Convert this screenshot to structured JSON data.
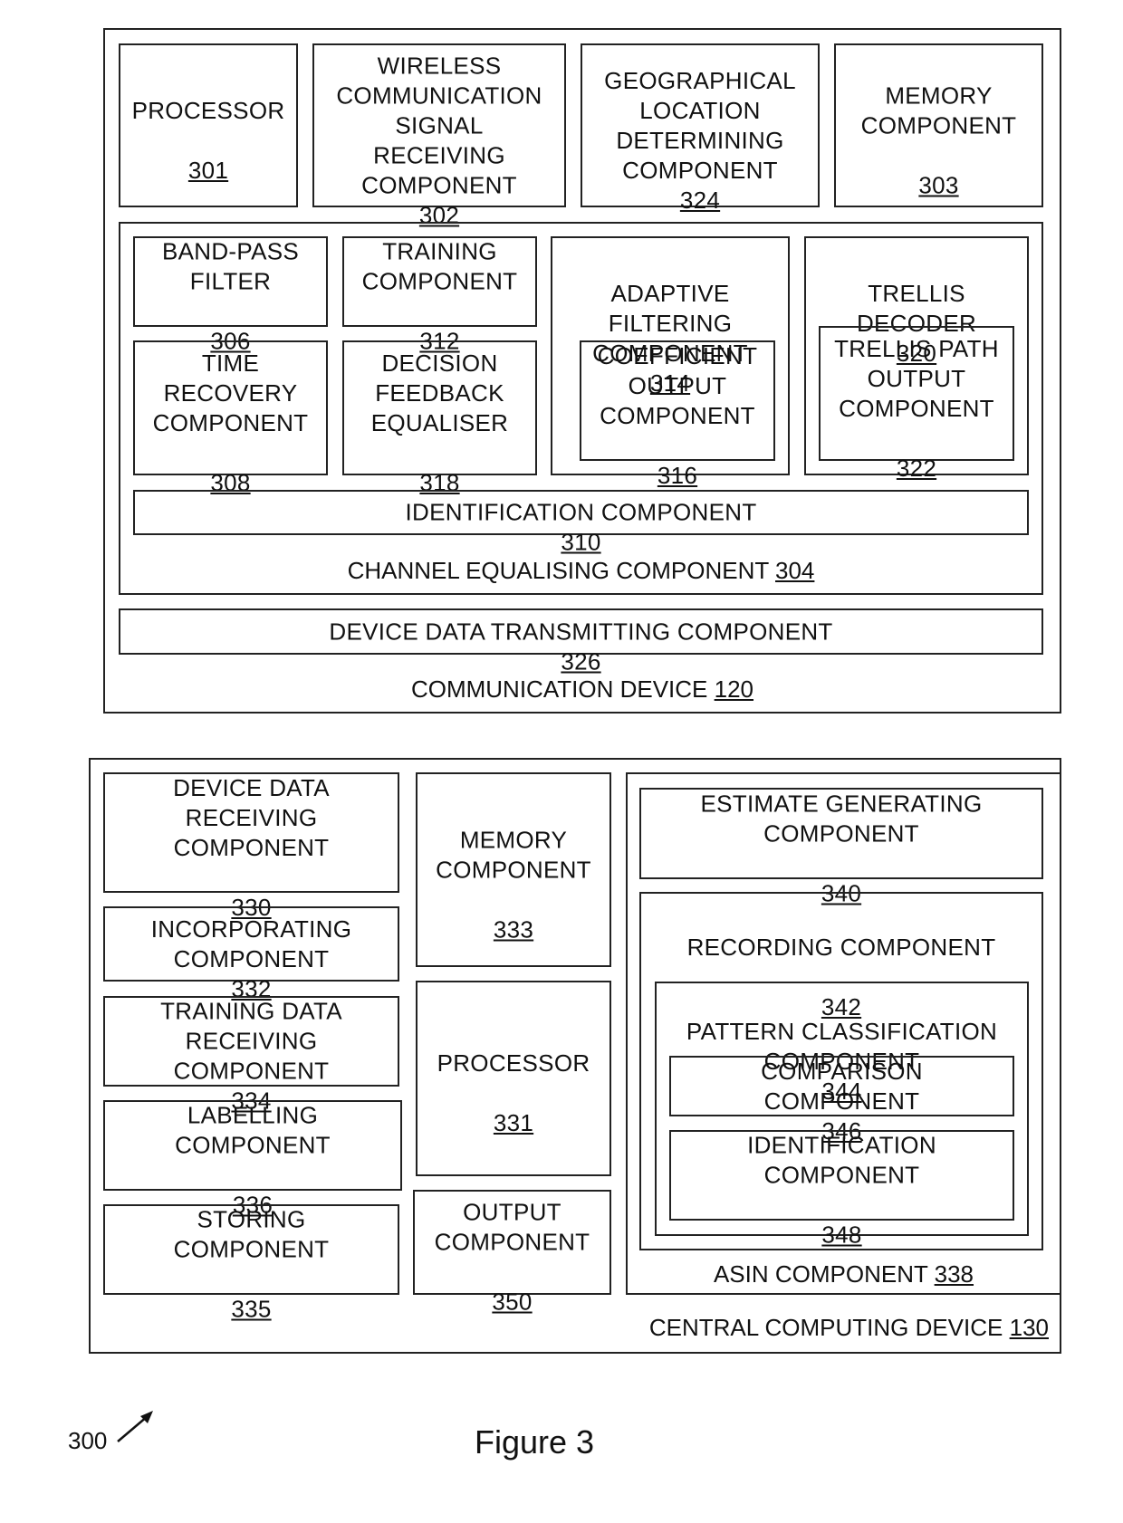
{
  "figure": {
    "caption": "Figure 3",
    "reference": "300"
  },
  "communication_device": {
    "label": "COMMUNICATION DEVICE",
    "num": "120",
    "processor": {
      "label": "PROCESSOR",
      "num": "301"
    },
    "wireless": {
      "label": "WIRELESS\nCOMMUNICATION\nSIGNAL\nRECEIVING\nCOMPONENT",
      "num": "302"
    },
    "geo": {
      "label": "GEOGRAPHICAL\nLOCATION\nDETERMINING\nCOMPONENT",
      "num": "324"
    },
    "memory": {
      "label": "MEMORY\nCOMPONENT",
      "num": "303"
    },
    "channel_equalising": {
      "label": "CHANNEL EQUALISING COMPONENT",
      "num": "304",
      "band_pass": {
        "label": "BAND-PASS\nFILTER",
        "num": "306"
      },
      "training": {
        "label": "TRAINING\nCOMPONENT",
        "num": "312"
      },
      "time_recovery": {
        "label": "TIME\nRECOVERY\nCOMPONENT",
        "num": "308"
      },
      "dfe": {
        "label": "DECISION\nFEEDBACK\nEQUALISER",
        "num": "318"
      },
      "adaptive": {
        "label": "ADAPTIVE\nFILTERING\nCOMPONENT",
        "num": "314"
      },
      "coefficient": {
        "label": "COEFFICIENT\nOUTPUT\nCOMPONENT",
        "num": "316"
      },
      "trellis": {
        "label": "TRELLIS\nDECODER",
        "num": "320"
      },
      "trellis_path": {
        "label": "TRELLIS PATH\nOUTPUT\nCOMPONENT",
        "num": "322"
      },
      "identification": {
        "label": "IDENTIFICATION COMPONENT",
        "num": "310"
      }
    },
    "device_data_tx": {
      "label": "DEVICE DATA TRANSMITTING COMPONENT",
      "num": "326"
    }
  },
  "central_computing_device": {
    "label": "CENTRAL COMPUTING DEVICE",
    "num": "130",
    "device_data_rx": {
      "label": "DEVICE DATA\nRECEIVING\nCOMPONENT",
      "num": "330"
    },
    "incorporating": {
      "label": "INCORPORATING\nCOMPONENT",
      "num": "332"
    },
    "training_data_rx": {
      "label": "TRAINING DATA\nRECEIVING\nCOMPONENT",
      "num": "334"
    },
    "labelling": {
      "label": "LABELLING\nCOMPONENT",
      "num": "336"
    },
    "storing": {
      "label": "STORING\nCOMPONENT",
      "num": "335"
    },
    "memory": {
      "label": "MEMORY\nCOMPONENT",
      "num": "333"
    },
    "processor": {
      "label": "PROCESSOR",
      "num": "331"
    },
    "output": {
      "label": "OUTPUT\nCOMPONENT",
      "num": "350"
    },
    "asin": {
      "label": "ASIN COMPONENT",
      "num": "338",
      "estimate": {
        "label": "ESTIMATE GENERATING\nCOMPONENT",
        "num": "340"
      },
      "recording": {
        "label": "RECORDING COMPONENT",
        "num": "342",
        "pattern": {
          "label": "PATTERN CLASSIFICATION\nCOMPONENT",
          "num": "344",
          "comparison": {
            "label": "COMPARISON\nCOMPONENT",
            "num": "346"
          },
          "identification": {
            "label": "IDENTIFICATION\nCOMPONENT",
            "num": "348"
          }
        }
      }
    }
  }
}
